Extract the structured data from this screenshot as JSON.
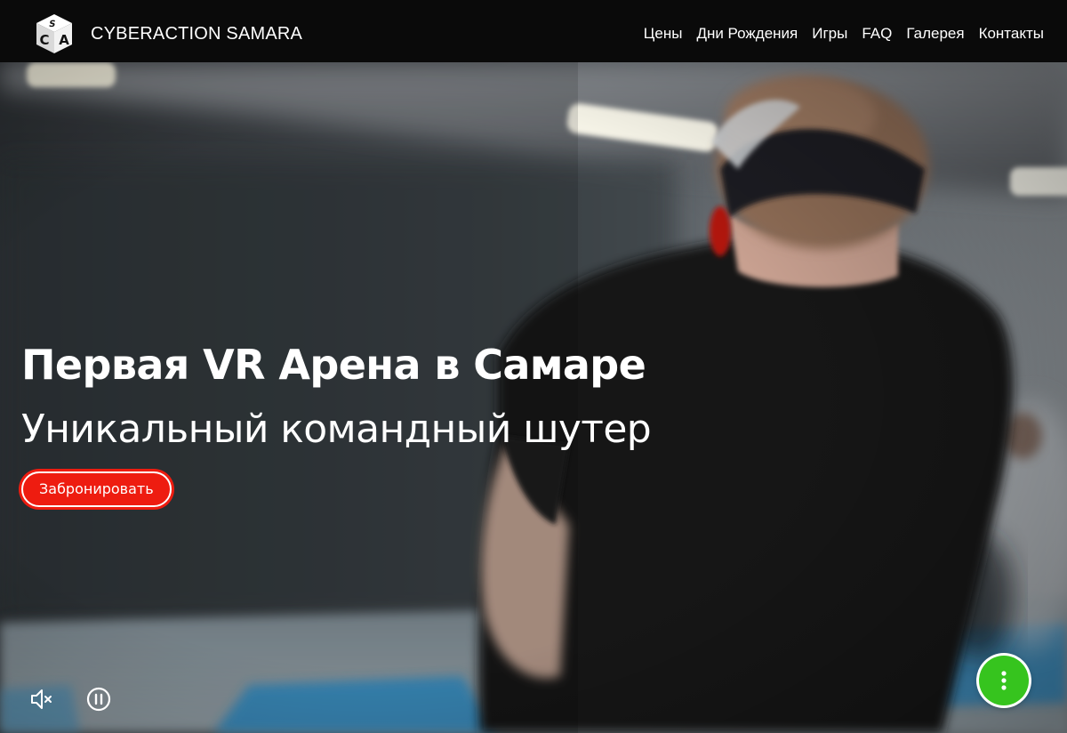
{
  "header": {
    "brand": "CYBERACTION SAMARA",
    "logo_icon": "sca-cube-logo",
    "nav": [
      {
        "label": "Цены"
      },
      {
        "label": "Дни Рождения"
      },
      {
        "label": "Игры"
      },
      {
        "label": "FAQ"
      },
      {
        "label": "Галерея"
      },
      {
        "label": "Контакты"
      }
    ]
  },
  "hero": {
    "title": "Первая VR Арена в Самаре",
    "subtitle": "Уникальный командный шутер",
    "cta_label": "Забронировать",
    "cta_color": "#ee1c10"
  },
  "video_controls": {
    "mute_icon": "volume-muted-icon",
    "pause_icon": "pause-circle-icon"
  },
  "floating_action": {
    "icon": "more-vertical-icon",
    "color": "#36c41e"
  }
}
